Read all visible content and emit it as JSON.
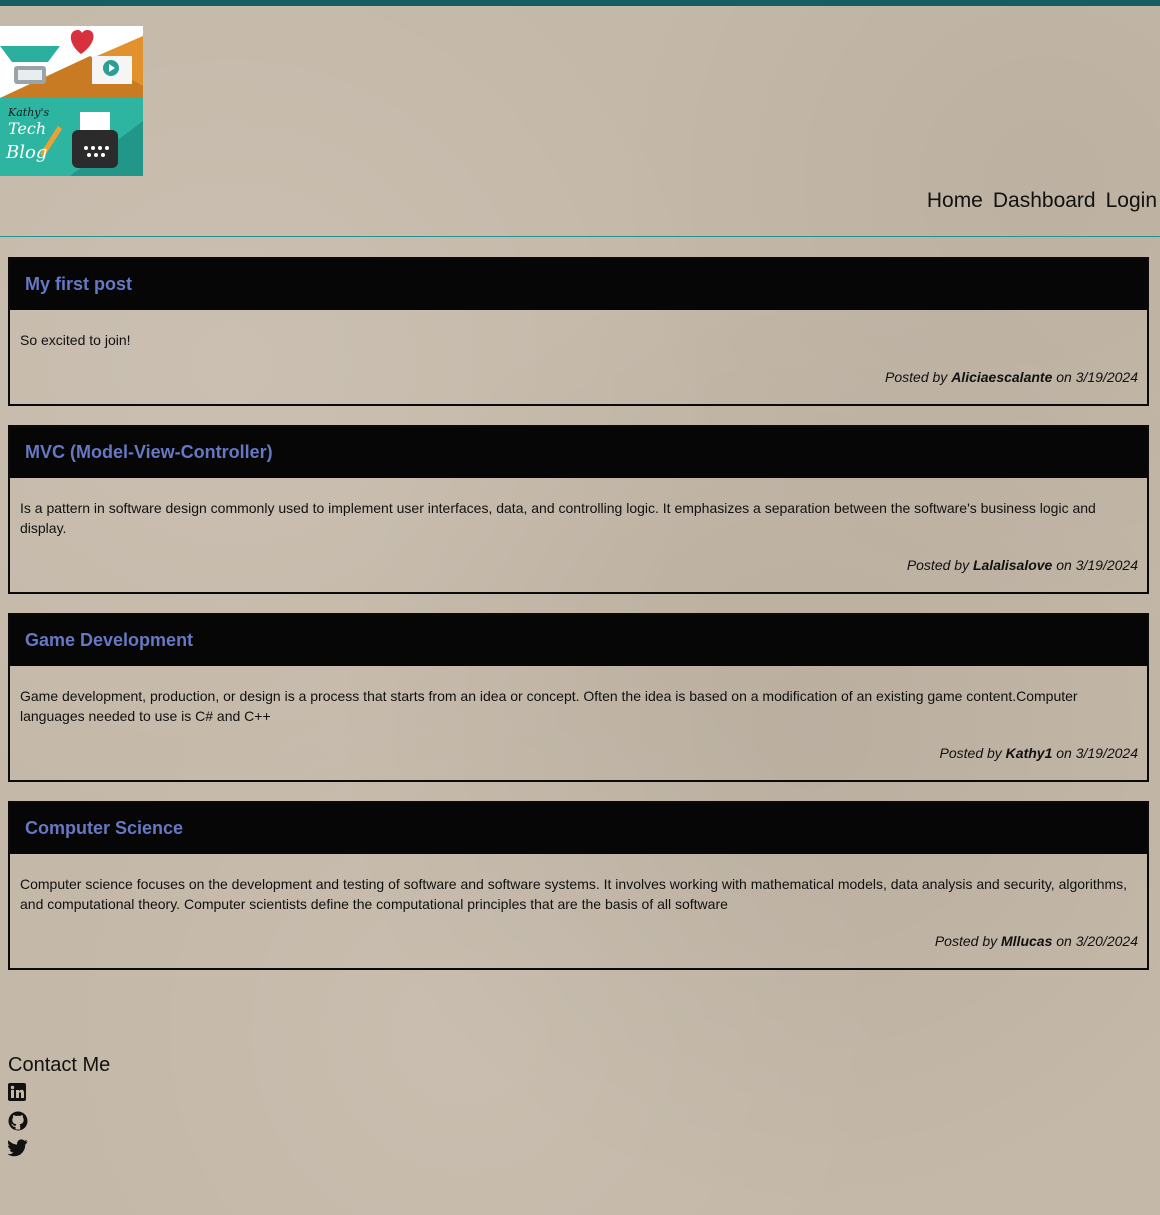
{
  "header": {
    "logo_text": [
      "Kathy's",
      "Tech",
      "Blog"
    ],
    "nav": [
      "Home",
      "Dashboard",
      "Login"
    ]
  },
  "posts": [
    {
      "title": "My first post",
      "content": "So excited to join!",
      "posted_by_prefix": "Posted by ",
      "author": "Aliciaescalante",
      "date_text": " on 3/19/2024"
    },
    {
      "title": "MVC (Model-View-Controller)",
      "content": "Is a pattern in software design commonly used to implement user interfaces, data, and controlling logic. It emphasizes a separation between the software's business logic and display.",
      "posted_by_prefix": "Posted by ",
      "author": "Lalalisalove",
      "date_text": " on 3/19/2024"
    },
    {
      "title": "Game Development",
      "content": "Game development, production, or design is a process that starts from an idea or concept. Often the idea is based on a modification of an existing game content.Computer languages needed to use is C# and C++",
      "posted_by_prefix": "Posted by ",
      "author": "Kathy1",
      "date_text": " on 3/19/2024"
    },
    {
      "title": "Computer Science",
      "content": "Computer science focuses on the development and testing of software and software systems. It involves working with mathematical models, data analysis and security, algorithms, and computational theory. Computer scientists define the computational principles that are the basis of all software",
      "posted_by_prefix": "Posted by ",
      "author": "Mllucas",
      "date_text": " on 3/20/2024"
    }
  ],
  "footer": {
    "title": "Contact Me",
    "social_icons": [
      "linkedin-icon",
      "github-icon",
      "twitter-icon"
    ]
  },
  "colors": {
    "top_bar": "#155e63",
    "post_title": "#6678c4",
    "post_header_bg": "#060606",
    "page_bg": "#c4b8a8"
  }
}
